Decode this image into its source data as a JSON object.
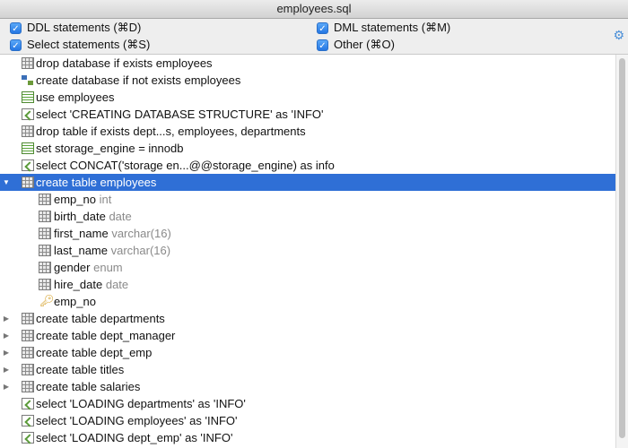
{
  "window": {
    "title": "employees.sql"
  },
  "filters": [
    {
      "label": "DDL statements (⌘D)",
      "checked": true
    },
    {
      "label": "DML statements (⌘M)",
      "checked": true
    },
    {
      "label": "Select statements (⌘S)",
      "checked": true
    },
    {
      "label": "Other (⌘O)",
      "checked": true
    }
  ],
  "settings_icon": "gear-icon",
  "tree": [
    {
      "label": "drop database if exists employees",
      "icon": "table-icon"
    },
    {
      "label": "create database if not exists employees",
      "icon": "database-icon"
    },
    {
      "label": "use employees",
      "icon": "statement-icon"
    },
    {
      "label": "select 'CREATING DATABASE STRUCTURE' as 'INFO'",
      "icon": "select-icon"
    },
    {
      "label": "drop table if exists dept...s, employees, departments",
      "icon": "table-icon"
    },
    {
      "label": "set storage_engine = innodb",
      "icon": "statement-icon"
    },
    {
      "label": "select CONCAT('storage en...@@storage_engine) as info",
      "icon": "select-icon"
    },
    {
      "label": "create table employees",
      "icon": "table-icon",
      "expanded": true,
      "selected": true,
      "children": [
        {
          "name": "emp_no",
          "type": "int",
          "icon": "key-column-icon"
        },
        {
          "name": "birth_date",
          "type": "date",
          "icon": "column-icon"
        },
        {
          "name": "first_name",
          "type": "varchar(16)",
          "icon": "column-icon"
        },
        {
          "name": "last_name",
          "type": "varchar(16)",
          "icon": "column-icon"
        },
        {
          "name": "gender",
          "type": "enum",
          "icon": "column-icon"
        },
        {
          "name": "hire_date",
          "type": "date",
          "icon": "column-icon"
        },
        {
          "name": "emp_no",
          "type": "",
          "icon": "key-icon"
        }
      ]
    },
    {
      "label": "create table departments",
      "icon": "table-icon",
      "collapsed": true
    },
    {
      "label": "create table dept_manager",
      "icon": "table-icon",
      "collapsed": true
    },
    {
      "label": "create table dept_emp",
      "icon": "table-icon",
      "collapsed": true
    },
    {
      "label": "create table titles",
      "icon": "table-icon",
      "collapsed": true
    },
    {
      "label": "create table salaries",
      "icon": "table-icon",
      "collapsed": true
    },
    {
      "label": "select 'LOADING departments' as 'INFO'",
      "icon": "select-icon"
    },
    {
      "label": "select 'LOADING employees' as 'INFO'",
      "icon": "select-icon"
    },
    {
      "label": "select 'LOADING dept_emp' as 'INFO'",
      "icon": "select-icon"
    }
  ]
}
